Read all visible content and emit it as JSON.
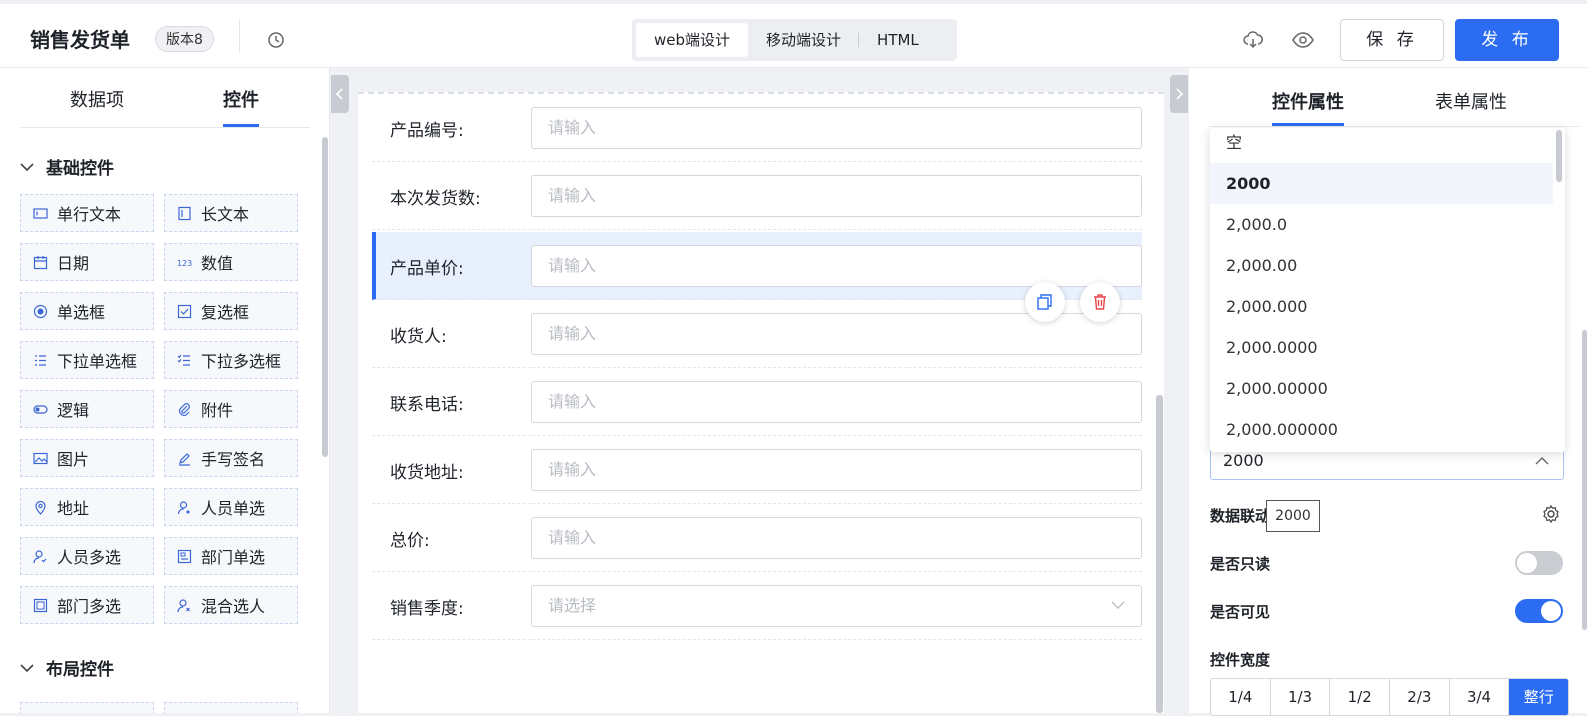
{
  "header": {
    "title": "销售发货单",
    "version": "版本8",
    "mode_tabs": [
      "web端设计",
      "移动端设计",
      "HTML"
    ],
    "save_label": "保 存",
    "publish_label": "发 布"
  },
  "left": {
    "tabs": [
      "数据项",
      "控件"
    ],
    "sections": [
      "基础控件",
      "布局控件"
    ],
    "controls": [
      {
        "label": "单行文本",
        "icon": "single-line-text-icon"
      },
      {
        "label": "长文本",
        "icon": "long-text-icon"
      },
      {
        "label": "日期",
        "icon": "calendar-icon"
      },
      {
        "label": "数值",
        "icon": "number-icon"
      },
      {
        "label": "单选框",
        "icon": "radio-icon"
      },
      {
        "label": "复选框",
        "icon": "checkbox-icon"
      },
      {
        "label": "下拉单选框",
        "icon": "dropdown-single-icon"
      },
      {
        "label": "下拉多选框",
        "icon": "dropdown-multi-icon"
      },
      {
        "label": "逻辑",
        "icon": "toggle-icon"
      },
      {
        "label": "附件",
        "icon": "paperclip-icon"
      },
      {
        "label": "图片",
        "icon": "image-icon"
      },
      {
        "label": "手写签名",
        "icon": "pen-icon"
      },
      {
        "label": "地址",
        "icon": "location-pin-icon"
      },
      {
        "label": "人员单选",
        "icon": "user-single-icon"
      },
      {
        "label": "人员多选",
        "icon": "user-multi-icon"
      },
      {
        "label": "部门单选",
        "icon": "department-single-icon"
      },
      {
        "label": "部门多选",
        "icon": "department-multi-icon"
      },
      {
        "label": "混合选人",
        "icon": "user-mixed-icon"
      }
    ]
  },
  "form": {
    "fields": [
      {
        "label": "产品编号:",
        "placeholder": "请输入"
      },
      {
        "label": "本次发货数:",
        "placeholder": "请输入"
      },
      {
        "label": "产品单价:",
        "placeholder": "请输入"
      },
      {
        "label": "收货人:",
        "placeholder": "请输入"
      },
      {
        "label": "联系电话:",
        "placeholder": "请输入"
      },
      {
        "label": "收货地址:",
        "placeholder": "请输入"
      },
      {
        "label": "总价:",
        "placeholder": "请输入"
      },
      {
        "label": "销售季度:",
        "placeholder": "请选择"
      }
    ]
  },
  "right": {
    "tabs": [
      "控件属性",
      "表单属性"
    ],
    "format_options": [
      "空",
      "2000",
      "2,000.0",
      "2,000.00",
      "2,000.000",
      "2,000.0000",
      "2,000.00000",
      "2,000.000000"
    ],
    "format_selected": "2000",
    "data_link_label": "数据联动",
    "tooltip": "2000",
    "readonly_label": "是否只读",
    "visible_label": "是否可见",
    "width_label": "控件宽度",
    "width_options": [
      "1/4",
      "1/3",
      "1/2",
      "2/3",
      "3/4",
      "整行"
    ],
    "readonly": false,
    "visible": true
  },
  "colors": {
    "accent": "#2b6cf2",
    "danger": "#e5484d"
  }
}
